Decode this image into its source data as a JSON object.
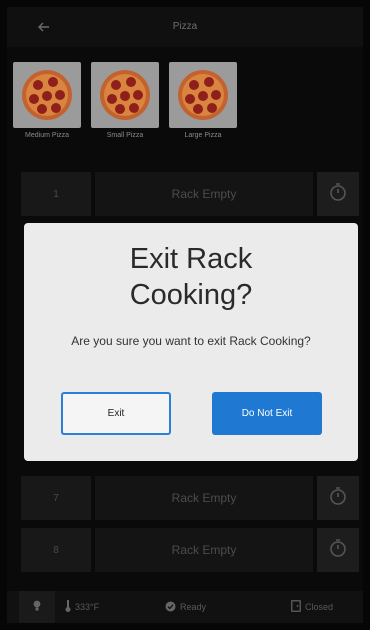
{
  "header": {
    "title": "Pizza",
    "back_icon": "arrow-left-icon"
  },
  "recipes": [
    {
      "label": "Medium Pizza",
      "icon": "pizza-icon"
    },
    {
      "label": "Small Pizza",
      "icon": "pizza-icon"
    },
    {
      "label": "Large Pizza",
      "icon": "pizza-icon"
    }
  ],
  "racks": [
    {
      "number": "1",
      "status": "Rack Empty",
      "icon": "timer-icon"
    },
    {
      "number": "7",
      "status": "Rack Empty",
      "icon": "timer-icon"
    },
    {
      "number": "8",
      "status": "Rack Empty",
      "icon": "timer-icon"
    }
  ],
  "footer": {
    "light_icon": "light-bulb-icon",
    "temperature": "333°F",
    "temperature_icon": "thermometer-icon",
    "state": "Ready",
    "state_icon": "check-circle-icon",
    "door": "Closed",
    "door_icon": "door-icon"
  },
  "dialog": {
    "title_line1": "Exit Rack",
    "title_line2": "Cooking?",
    "message": "Are you sure you want to exit Rack Cooking?",
    "exit_label": "Exit",
    "stay_label": "Do Not Exit"
  },
  "colors": {
    "dialog_background": "#ebebeb",
    "primary_button": "#1f78d1",
    "outline_button_border": "#2a7fd6",
    "screen_background": "#0a0a0a"
  }
}
